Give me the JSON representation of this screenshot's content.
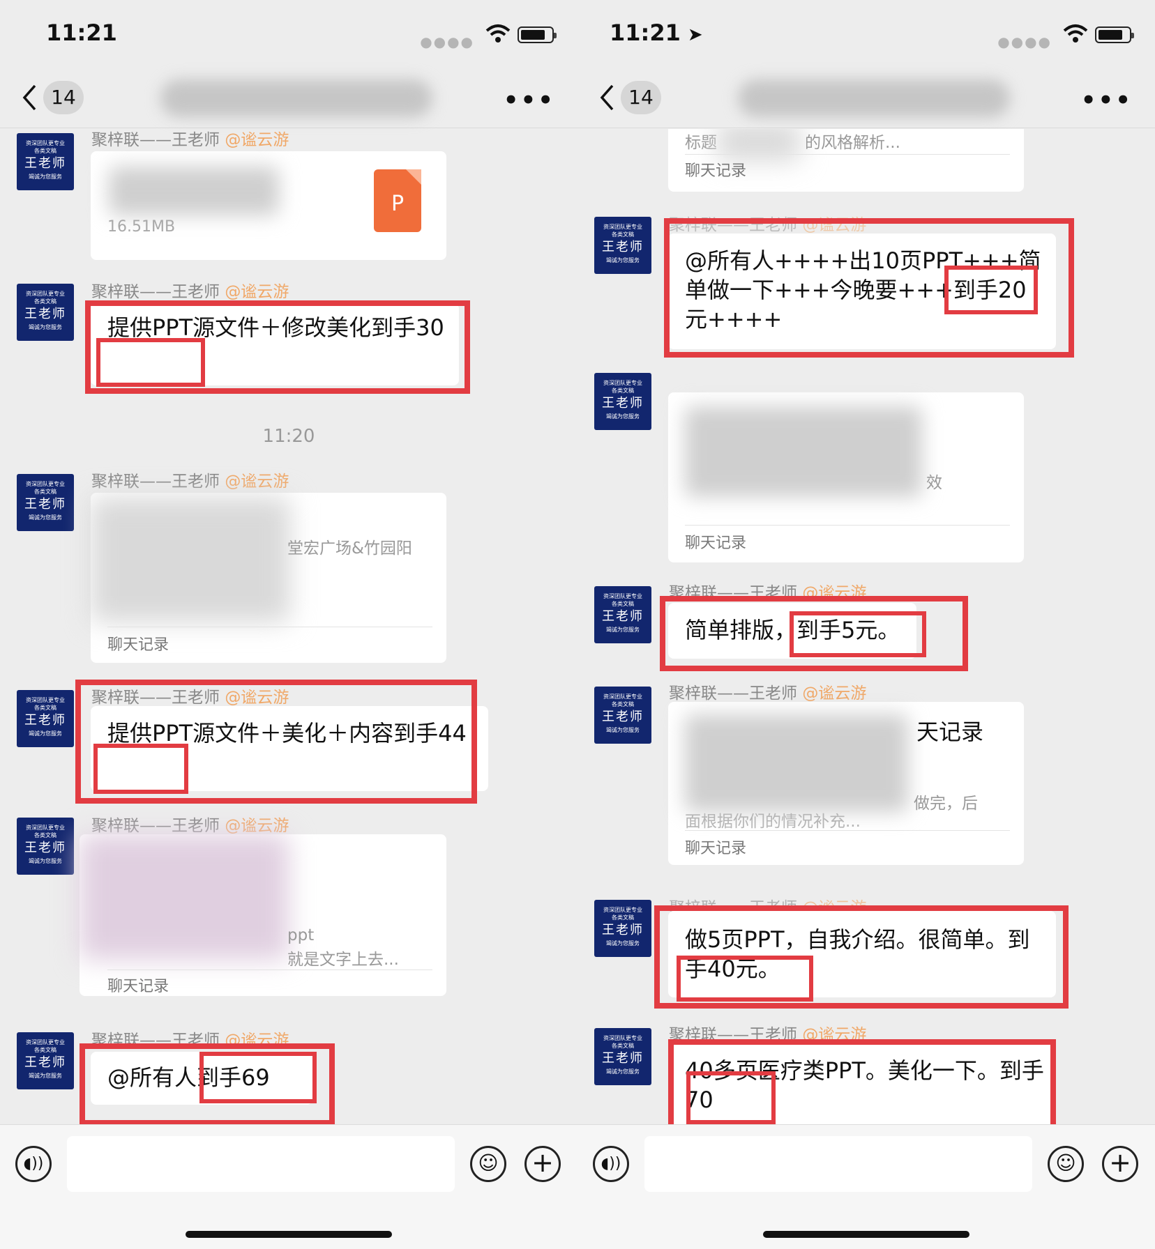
{
  "colors": {
    "highlight": "#e23c42",
    "mention": "#f0a868",
    "avatar_bg": "#12266e",
    "ppt_icon": "#f06d3a",
    "chat_bg": "#ededed"
  },
  "icons": [
    "back-chevron-icon",
    "more-icon",
    "wifi-icon",
    "battery-icon",
    "location-arrow-icon",
    "voice-icon",
    "emoji-icon",
    "plus-icon",
    "ppt-file-icon"
  ],
  "avatar": {
    "line1": "资深团队更专业",
    "line2": "各类文稿",
    "line3": "王老师",
    "line4": "竭诚为您服务"
  },
  "sender": {
    "name": "聚梓联——王老师",
    "mention": "@谧云游"
  },
  "left": {
    "status_time": "11:21",
    "nav": {
      "badge": "14"
    },
    "file_message": {
      "size": "16.51MB",
      "icon_letter": "P"
    },
    "msg_30": "提供PPT源文件＋修改美化到手30",
    "time_divider": "11:20",
    "record_1": {
      "snippet": "堂宏广场&竹园阳",
      "label": "聊天记录"
    },
    "msg_44": "提供PPT源文件＋美化＋内容到手44",
    "record_2": {
      "snippet_1": "ppt",
      "snippet_2": "就是文字上去...",
      "label": "聊天记录"
    },
    "msg_69": "@所有人到手69"
  },
  "right": {
    "status_time": "11:21",
    "nav": {
      "badge": "14"
    },
    "record_top": {
      "title_start": "标题",
      "title_end": "的风格解析...",
      "label": "聊天记录"
    },
    "msg_20": "@所有人++++出10页PPT+++简单做一下+++今晚要+++到手20元++++",
    "record_mid": {
      "snippet": "效",
      "label": "聊天记录"
    },
    "msg_5": "简单排版，到手5元。",
    "record_lower": {
      "title_end": "天记录",
      "snippet_1": "做完，后",
      "snippet_2": "面根据你们的情况补充...",
      "label": "聊天记录"
    },
    "msg_40": "做5页PPT，自我介绍。很简单。到手40元。",
    "msg_70": "40多页医疗类PPT。美化一下。到手70"
  }
}
